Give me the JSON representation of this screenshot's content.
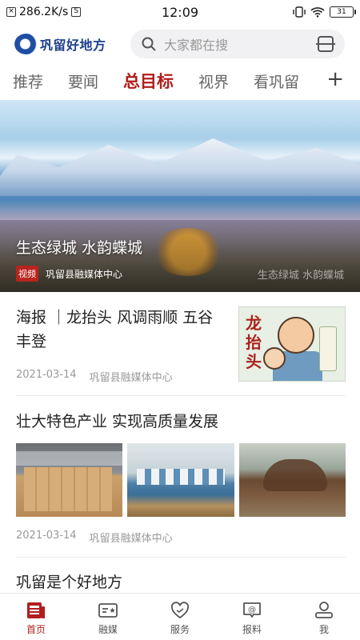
{
  "status_bar": {
    "net_speed": "286.2K/s",
    "time": "12:09",
    "battery": "31"
  },
  "header": {
    "logo_text": "巩留好地方",
    "search_placeholder": "大家都在搜"
  },
  "tabs": [
    {
      "label": "推荐",
      "active": false
    },
    {
      "label": "要闻",
      "active": false
    },
    {
      "label": "总目标",
      "active": true
    },
    {
      "label": "视界",
      "active": false
    },
    {
      "label": "看巩留",
      "active": false
    }
  ],
  "tab_add": "+",
  "hero": {
    "title": "生态绿城 水韵蝶城",
    "badge": "视频",
    "source": "巩留县融媒体中心",
    "watermark": "生态绿城 水韵蝶城"
  },
  "articles": [
    {
      "title": "海报 ｜龙抬头 风调雨顺 五谷丰登",
      "thumb_text": "龙抬头",
      "date": "2021-03-14",
      "source": "巩留县融媒体中心"
    },
    {
      "title": "壮大特色产业 实现高质量发展",
      "date": "2021-03-14",
      "source": "巩留县融媒体中心"
    },
    {
      "title": "巩留是个好地方"
    }
  ],
  "bottom_nav": [
    {
      "label": "首页",
      "icon": "newspaper-icon",
      "active": true
    },
    {
      "label": "融媒",
      "icon": "media-card-icon",
      "active": false
    },
    {
      "label": "服务",
      "icon": "heart-icon",
      "active": false
    },
    {
      "label": "报料",
      "icon": "at-message-icon",
      "active": false
    },
    {
      "label": "我",
      "icon": "user-icon",
      "active": false
    }
  ],
  "colors": {
    "accent": "#b21d1d",
    "logo_blue": "#1d3f8f"
  }
}
